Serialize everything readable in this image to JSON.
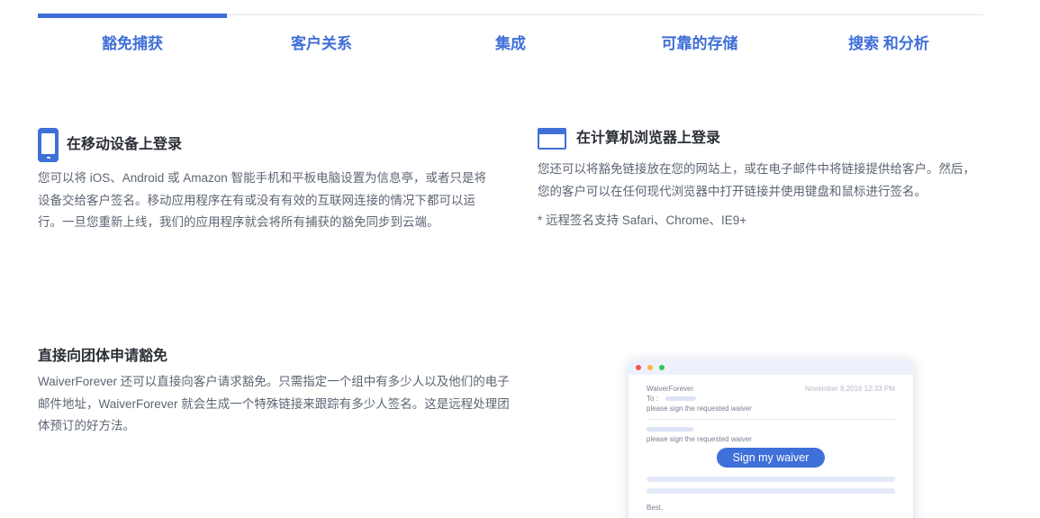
{
  "tabs": [
    {
      "label": "豁免捕获",
      "active": true
    },
    {
      "label": "客户关系",
      "active": false
    },
    {
      "label": "集成",
      "active": false
    },
    {
      "label": "可靠的存储",
      "active": false
    },
    {
      "label": "搜索 和分析",
      "active": false
    }
  ],
  "features": {
    "mobile": {
      "icon": "mobile-phone-icon",
      "title": "在移动设备上登录",
      "body": "您可以将 iOS、Android 或 Amazon 智能手机和平板电脑设置为信息亭，或者只是将设备交给客户签名。移动应用程序在有或没有有效的互联网连接的情况下都可以运行。一旦您重新上线，我们的应用程序就会将所有捕获的豁免同步到云端。"
    },
    "browser": {
      "icon": "browser-window-icon",
      "title": "在计算机浏览器上登录",
      "body": "您还可以将豁免链接放在您的网站上，或在电子邮件中将链接提供给客户。然后，您的客户可以在任何现代浏览器中打开链接并使用键盘和鼠标进行签名。",
      "note": "* 远程签名支持 Safari、Chrome、IE9+"
    },
    "group": {
      "title": "直接向团体申请豁免",
      "body": "WaiverForever 还可以直接向客户请求豁免。只需指定一个组中有多少人以及他们的电子邮件地址，WaiverForever 就会生成一个特殊链接来跟踪有多少人签名。这是远程处理团体预订的好方法。"
    }
  },
  "email_card": {
    "from": "WaiverForever",
    "date": "November 8,2016 12:33 PM",
    "to_label": "To :",
    "line1": "please sign the requested waiver",
    "line2": "please sign the requested waiver",
    "button_label": "Sign my waiver",
    "closing": "Best,"
  },
  "colors": {
    "accent": "#3f6fd8",
    "text_dark": "#2b2f36",
    "text_body": "#5d6573"
  }
}
